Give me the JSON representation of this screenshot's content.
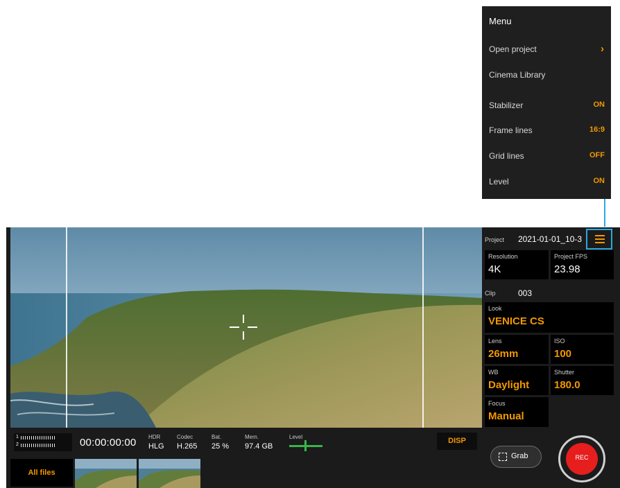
{
  "menu": {
    "title": "Menu",
    "items": [
      {
        "label": "Open project",
        "value": "",
        "chevron": "›"
      },
      {
        "label": "Cinema Library",
        "value": ""
      },
      {
        "label": "Stabilizer",
        "value": "ON"
      },
      {
        "label": "Frame lines",
        "value": "16:9"
      },
      {
        "label": "Grid lines",
        "value": "OFF"
      },
      {
        "label": "Level",
        "value": "ON"
      }
    ]
  },
  "status": {
    "meter_ch1": "1",
    "meter_ch2": "2",
    "timecode": "00:00:00:00",
    "hdr_label": "HDR",
    "hdr_value": "HLG",
    "codec_label": "Codec",
    "codec_value": "H.265",
    "bat_label": "Bat.",
    "bat_value": "25 %",
    "mem_label": "Mem.",
    "mem_value": "97.4 GB",
    "level_label": "Level",
    "disp_label": "DISP"
  },
  "bottom": {
    "all_files_label": "All files",
    "grab_label": "Grab",
    "rec_label": "REC"
  },
  "panel": {
    "project_label": "Project",
    "project_value": "2021-01-01_10-3",
    "resolution_label": "Resolution",
    "resolution_value": "4K",
    "fps_label": "Project FPS",
    "fps_value": "23.98",
    "clip_label": "Clip",
    "clip_value": "003",
    "look_label": "Look",
    "look_value": "VENICE CS",
    "lens_label": "Lens",
    "lens_value": "26mm",
    "iso_label": "ISO",
    "iso_value": "100",
    "wb_label": "WB",
    "wb_value": "Daylight",
    "shutter_label": "Shutter",
    "shutter_value": "180.0",
    "focus_label": "Focus",
    "focus_value": "Manual"
  },
  "colors": {
    "accent": "#f39800",
    "highlight": "#2aa9e0",
    "rec": "#e61e1e",
    "level": "#39b54a"
  },
  "icons": [
    "menu-icon",
    "chevron-right-icon",
    "grab-icon",
    "rec-icon",
    "level-indicator-icon"
  ]
}
